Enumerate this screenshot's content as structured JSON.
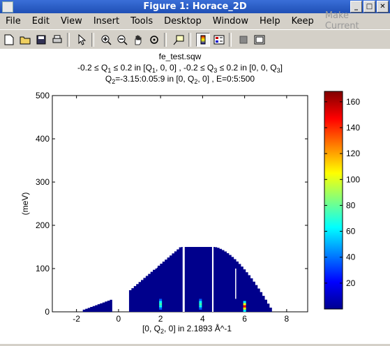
{
  "window": {
    "title": "Figure 1: Horace_2D"
  },
  "menu": [
    "File",
    "Edit",
    "View",
    "Insert",
    "Tools",
    "Desktop",
    "Window",
    "Help",
    "Keep",
    "Make Current"
  ],
  "toolbar": {
    "icons": [
      "new-file-icon",
      "open-folder-icon",
      "save-icon",
      "print-icon",
      "pointer-icon",
      "zoom-in-icon",
      "zoom-out-icon",
      "pan-hand-icon",
      "rotate-icon",
      "data-cursor-icon",
      "colorbar-icon",
      "legend-icon",
      "hide-plot-tools-icon",
      "show-plot-tools-icon"
    ]
  },
  "colors": {
    "titlebar": "#2a5cc8",
    "plot_fill": "#00008c",
    "background": "#d4d0c8"
  },
  "chart_data": {
    "type": "heatmap",
    "title_lines": [
      "fe_test.sqw",
      "-0.2 ≤ Q",
      "Q",
      "=-3.15:0.05:9 in [0, Q",
      ", 0] , E=0:5:500"
    ],
    "title_line2_parts": [
      "-0.2 ≤ Q",
      "1",
      " ≤ 0.2 in [Q",
      "1",
      ", 0, 0] , -0.2 ≤ Q",
      "3",
      " ≤ 0.2 in [0, 0, Q",
      "3",
      "]"
    ],
    "title_line3_parts": [
      "Q",
      "2",
      "=-3.15:0.05:9 in [0, Q",
      "2",
      ", 0] , E=0:5:500"
    ],
    "xlabel_parts": [
      "[0, Q",
      "2",
      ", 0] in 2.1893 Å^-1"
    ],
    "ylabel": "(meV)",
    "x_ticks": [
      "-2",
      "0",
      "2",
      "4",
      "6",
      "8"
    ],
    "y_ticks": [
      "0",
      "100",
      "200",
      "300",
      "400",
      "500"
    ],
    "xlim": [
      -3.15,
      9
    ],
    "ylim": [
      0,
      500
    ],
    "colorbar_ticks": [
      "20",
      "40",
      "60",
      "80",
      "100",
      "120",
      "140",
      "160"
    ],
    "colorbar_range": [
      0,
      168
    ],
    "regions": [
      {
        "name": "left",
        "x": [
          -1.7,
          -0.3
        ],
        "top": [
          5,
          30
        ]
      },
      {
        "name": "main",
        "x": [
          0.5,
          7.3
        ],
        "top": [
          150,
          0
        ]
      }
    ],
    "hotspots": [
      {
        "x": 2.0,
        "e": [
          5,
          30
        ],
        "max": 70
      },
      {
        "x": 3.9,
        "e": [
          5,
          30
        ],
        "max": 70
      },
      {
        "x": 6.0,
        "e": [
          0,
          25
        ],
        "max": 130
      }
    ]
  }
}
